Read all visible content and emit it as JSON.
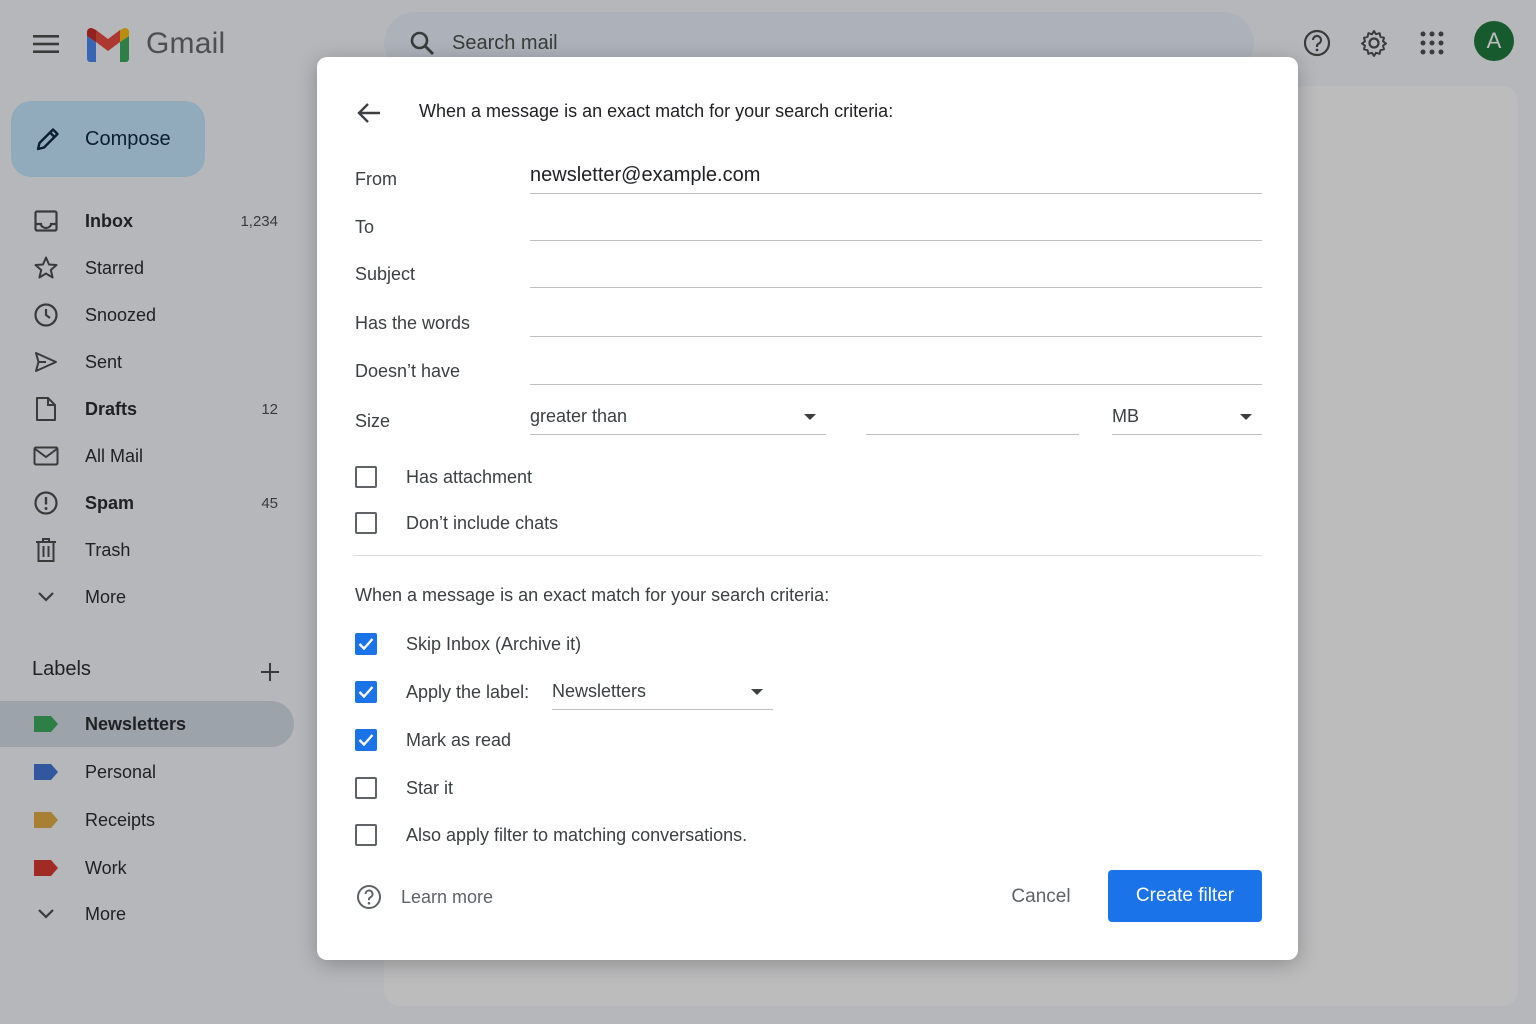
{
  "app": {
    "name": "Gmail",
    "search_placeholder": "Search mail",
    "avatar_letter": "A",
    "brand_colors": {
      "red": "#ea4335",
      "blue": "#4285f4",
      "green": "#34a853",
      "yellow": "#fbbc04"
    },
    "icons": {
      "menu": "menu-icon",
      "search": "search-icon",
      "help": "help-icon",
      "settings": "gear-icon",
      "apps": "apps-grid-icon"
    }
  },
  "sidebar": {
    "compose_label": "Compose",
    "items": [
      {
        "label": "Inbox",
        "count": "1,234",
        "icon": "inbox-icon",
        "bold": true
      },
      {
        "label": "Starred",
        "count": "",
        "icon": "star-icon",
        "bold": false
      },
      {
        "label": "Snoozed",
        "count": "",
        "icon": "clock-icon",
        "bold": false
      },
      {
        "label": "Sent",
        "count": "",
        "icon": "send-icon",
        "bold": false
      },
      {
        "label": "Drafts",
        "count": "12",
        "icon": "draft-icon",
        "bold": true
      },
      {
        "label": "All Mail",
        "count": "",
        "icon": "mail-icon",
        "bold": false
      },
      {
        "label": "Spam",
        "count": "45",
        "icon": "spam-icon",
        "bold": true
      },
      {
        "label": "Trash",
        "count": "",
        "icon": "trash-icon",
        "bold": false
      },
      {
        "label": "More",
        "count": "",
        "icon": "chevron-down-icon",
        "bold": false
      }
    ],
    "labels_heading": "Labels",
    "labels": [
      {
        "label": "Newsletters",
        "color": "#34a853",
        "active": true
      },
      {
        "label": "Personal",
        "color": "#3b6fd4",
        "active": false
      },
      {
        "label": "Receipts",
        "color": "#e2a93b",
        "active": false
      },
      {
        "label": "Work",
        "color": "#d93025",
        "active": false
      }
    ],
    "labels_more": "More"
  },
  "filter_dialog": {
    "title": "When a message is an exact match for your search criteria:",
    "fields": {
      "from_label": "From",
      "from_value": "newsletter@example.com",
      "to_label": "To",
      "to_value": "",
      "subject_label": "Subject",
      "subject_value": "",
      "has_words_label": "Has the words",
      "has_words_value": "",
      "doesnt_have_label": "Doesn’t have",
      "doesnt_have_value": "",
      "size_label": "Size",
      "size_operator": "greater than",
      "size_value": "",
      "size_unit": "MB"
    },
    "criteria_checkboxes": [
      {
        "label": "Has attachment",
        "checked": false
      },
      {
        "label": "Don’t include chats",
        "checked": false
      }
    ],
    "actions_title": "When a message is an exact match for your search criteria:",
    "actions": [
      {
        "label": "Skip Inbox (Archive it)",
        "checked": true
      },
      {
        "label": "Apply the label:",
        "checked": true
      },
      {
        "label": "Mark as read",
        "checked": true
      },
      {
        "label": "Star it",
        "checked": false
      },
      {
        "label": "Also apply filter to matching conversations.",
        "checked": false
      }
    ],
    "apply_label_value": "Newsletters",
    "learn_more": "Learn more",
    "cancel_label": "Cancel",
    "create_label": "Create filter",
    "accent_color": "#1a73e8"
  }
}
